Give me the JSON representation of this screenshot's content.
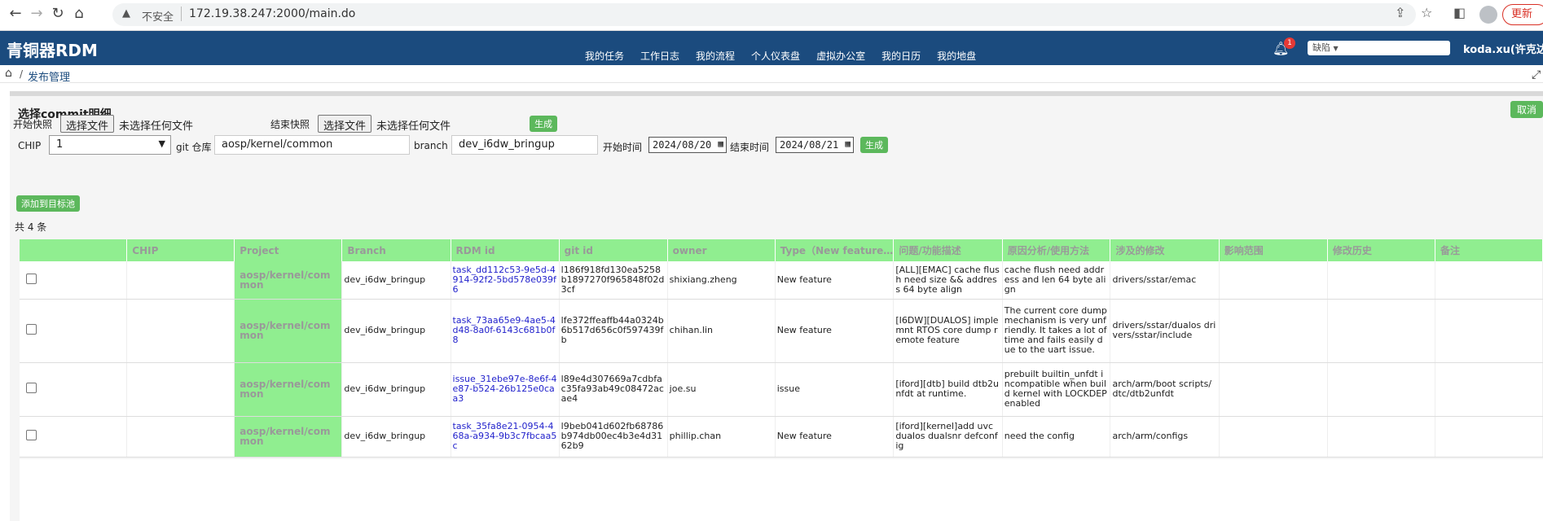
{
  "browser": {
    "security_label": "不安全",
    "url": "172.19.38.247:2000/main.do",
    "update_label": "更新"
  },
  "app": {
    "brand": "青铜器RDM",
    "menu": [
      "我的任务",
      "工作日志",
      "我的流程",
      "个人仪表盘",
      "虚拟办公室",
      "我的日历",
      "我的地盘"
    ],
    "notification_count": "1",
    "leave_select": "缺陷",
    "user": "koda.xu(许克达"
  },
  "breadcrumb": {
    "label": "发布管理"
  },
  "dialog": {
    "title": "选择commit明细",
    "cancel_label": "取消",
    "start_snapshot_label": "开始快照",
    "end_snapshot_label": "结束快照",
    "choose_file_label": "选择文件",
    "no_file_label": "未选择任何文件",
    "generate_label": "生成",
    "chip_label": "CHIP",
    "chip_value": "1",
    "git_repo_label": "git 仓库",
    "git_repo_value": "aosp/kernel/common",
    "branch_label": "branch",
    "branch_value": "dev_i6dw_bringup",
    "start_time_label": "开始时间",
    "start_time_value": "2024/08/20",
    "end_time_label": "结束时间",
    "end_time_value": "2024/08/21",
    "add_to_pool_label": "添加到目标池",
    "count_label": "共 4 条"
  },
  "table": {
    "headers": [
      "",
      "CHIP",
      "Project",
      "Branch",
      "RDM id",
      "git id",
      "owner",
      "Type（New feature…",
      "问题/功能描述",
      "原因分析/使用方法",
      "涉及的修改",
      "影响范围",
      "修改历史",
      "备注"
    ],
    "rows": [
      {
        "chip": "",
        "project": "aosp/kernel/common",
        "branch": "dev_i6dw_bringup",
        "rdm_id": "task_dd112c53-9e5d-4914-92f2-5bd578e039f6",
        "git_id": "l186f918fd130ea5258b1897270f965848f02d3cf",
        "owner": "shixiang.zheng",
        "type": "New feature",
        "desc": "[ALL][EMAC] cache flush need size && address 64 byte align",
        "reason": "cache flush need address and len 64 byte align",
        "changes": "drivers/sstar/emac",
        "impact": "",
        "history": "",
        "note": ""
      },
      {
        "chip": "",
        "project": "aosp/kernel/common",
        "branch": "dev_i6dw_bringup",
        "rdm_id": "task_73aa65e9-4ae5-4d48-8a0f-6143c681b0f8",
        "git_id": "lfe372ffeaffb44a0324b6b517d656c0f597439fb",
        "owner": "chihan.lin",
        "type": "New feature",
        "desc": "[I6DW][DUALOS] implemnt RTOS core dump remote feature",
        "reason": "The current core dump mechanism is very unfriendly. It takes a lot of time and fails easily due to the uart issue.",
        "changes": "drivers/sstar/dualos drivers/sstar/include",
        "impact": "",
        "history": "",
        "note": ""
      },
      {
        "chip": "",
        "project": "aosp/kernel/common",
        "branch": "dev_i6dw_bringup",
        "rdm_id": "issue_31ebe97e-8e6f-4e87-b524-26b125e0caa3",
        "git_id": "l89e4d307669a7cdbfac35fa93ab49c08472acae4",
        "owner": "joe.su",
        "type": "issue",
        "desc": "[iford][dtb] build dtb2unfdt at runtime.",
        "reason": "prebuilt builtin_unfdt incompatible when build kernel with LOCKDEP enabled",
        "changes": "arch/arm/boot scripts/dtc/dtb2unfdt",
        "impact": "",
        "history": "",
        "note": ""
      },
      {
        "chip": "",
        "project": "aosp/kernel/common",
        "branch": "dev_i6dw_bringup",
        "rdm_id": "task_35fa8e21-0954-468a-a934-9b3c7fbcaa5c",
        "git_id": "l9beb041d602fb68786b974db00ec4b3e4d3162b9",
        "owner": "phillip.chan",
        "type": "New feature",
        "desc": "[iford][kernel]add uvc dualos dualsnr defconfig",
        "reason": "need the config",
        "changes": "arch/arm/configs",
        "impact": "",
        "history": "",
        "note": ""
      }
    ]
  }
}
